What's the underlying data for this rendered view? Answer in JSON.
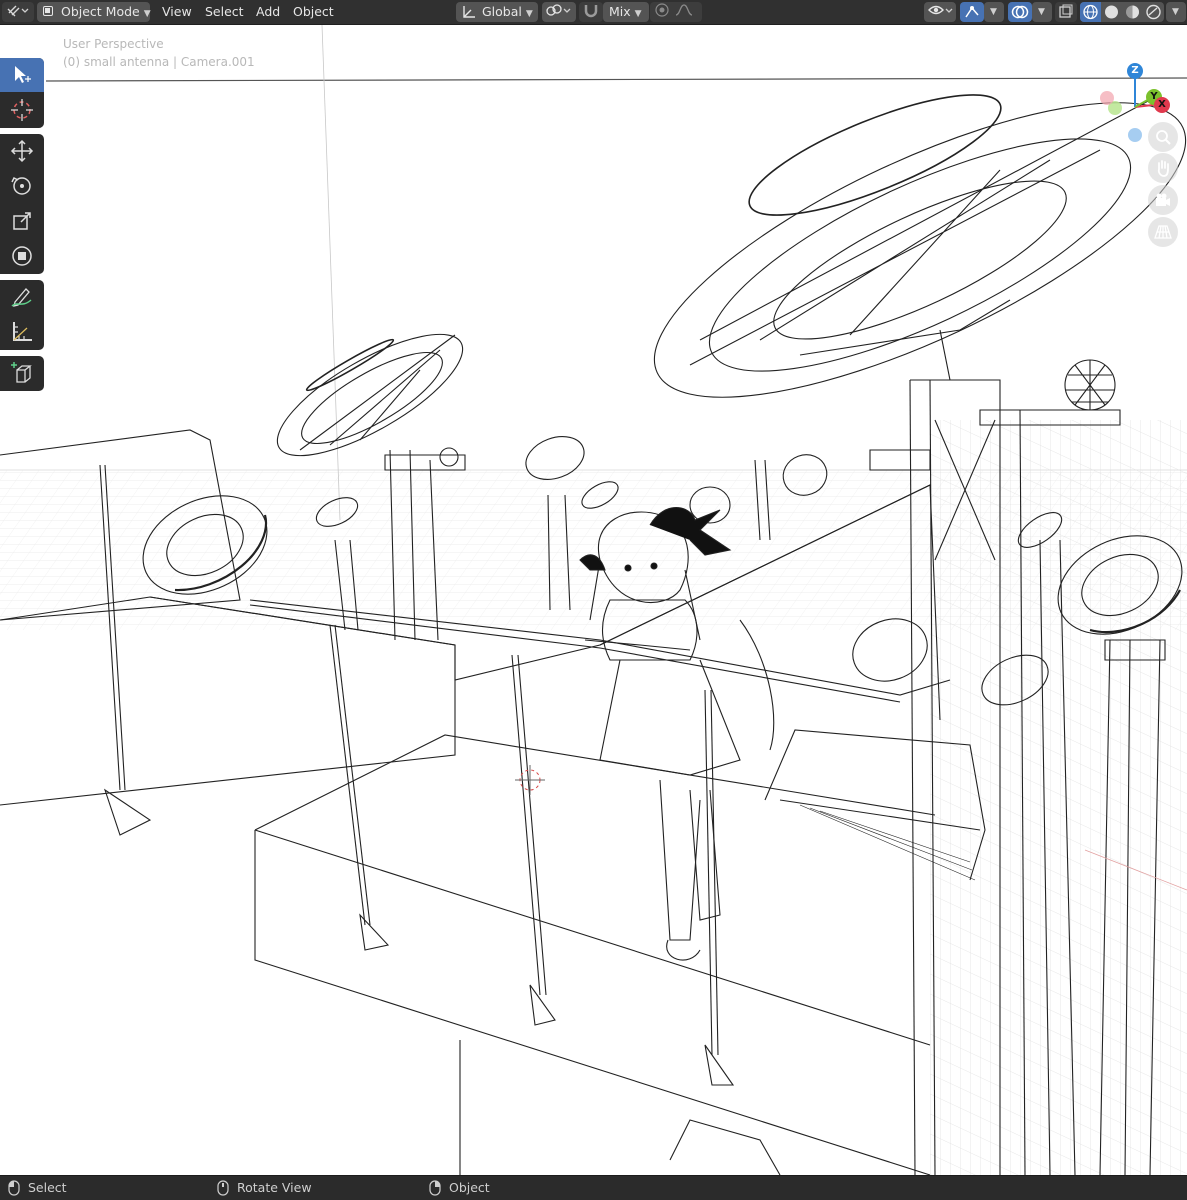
{
  "header": {
    "mode_label": "Object Mode",
    "menu": [
      "View",
      "Select",
      "Add",
      "Object"
    ],
    "orientation_label": "Global",
    "snap_mode_label": "Mix"
  },
  "viewport": {
    "perspective_label": "User Perspective",
    "object_info": "(0) small antenna | Camera.001"
  },
  "gizmo": {
    "x": "X",
    "y": "Y",
    "z": "Z"
  },
  "statusbar": {
    "left_click": "Select",
    "middle_click": "Rotate View",
    "right_click": "Object"
  },
  "colors": {
    "header_bg": "#303030",
    "button_bg": "#545454",
    "accent_blue": "#4772b3",
    "axis_x": "#e0394d",
    "axis_y": "#7bc12d",
    "axis_z": "#2f86d8"
  }
}
